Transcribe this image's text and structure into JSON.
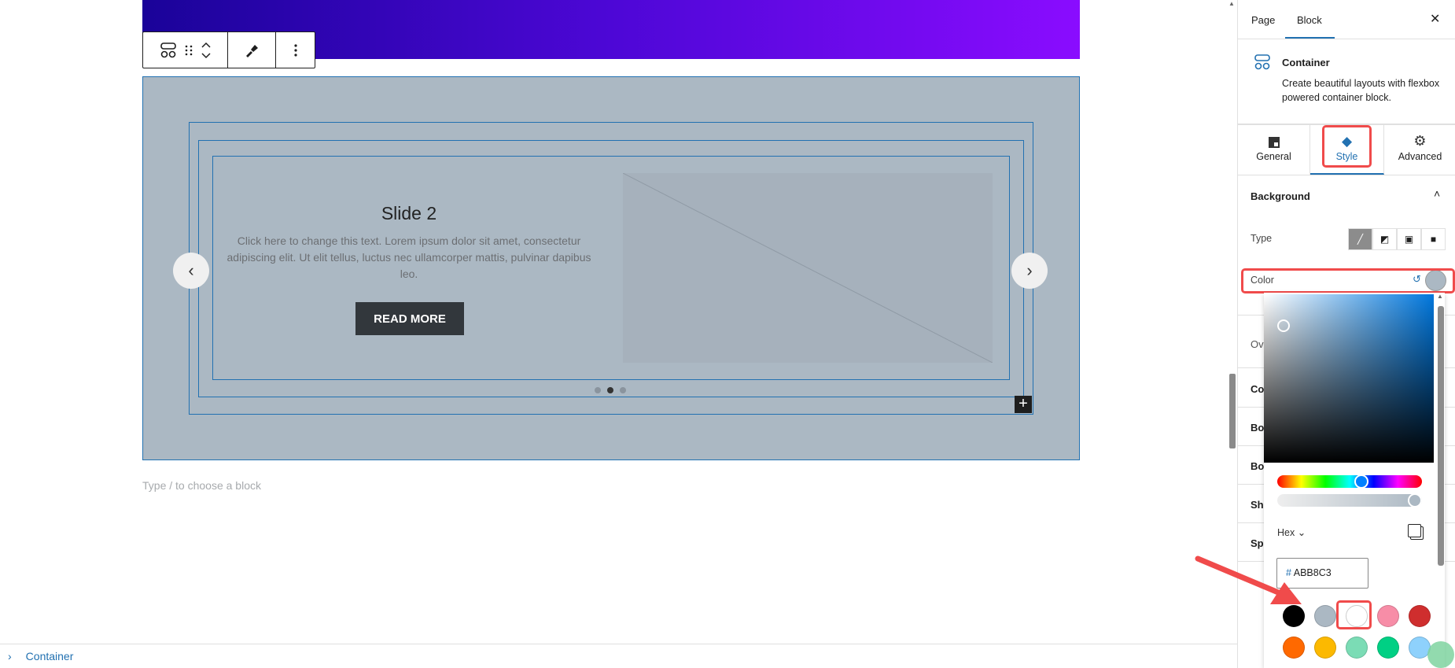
{
  "editor": {
    "toolbar": {
      "block_icon": "container-icon",
      "drag_icon": "drag-handle-icon",
      "move_icon": "move-up-down-icon",
      "style_icon": "paintbrush-icon",
      "more_icon": "more-vertical-icon"
    },
    "slide": {
      "title": "Slide 2",
      "body": "Click here to change this text. Lorem ipsum dolor sit amet, consectetur adipiscing elit. Ut elit tellus, luctus nec ullamcorper mattis, pulvinar dapibus leo.",
      "button": "READ MORE",
      "prev": "‹",
      "next": "›",
      "dots": 3,
      "active_dot": 2
    },
    "add_block": "+",
    "placeholder": "Type / to choose a block",
    "breadcrumb": {
      "chevron": "›",
      "label": "Container"
    }
  },
  "sidebar": {
    "tabs": [
      "Page",
      "Block"
    ],
    "active_tab": "Block",
    "close": "✕",
    "block": {
      "name": "Container",
      "description": "Create beautiful layouts with flexbox powered container block."
    },
    "sub_tabs": [
      {
        "label": "General",
        "icon": "general-icon"
      },
      {
        "label": "Style",
        "icon": "paint-bucket-icon"
      },
      {
        "label": "Advanced",
        "icon": "gear-icon"
      }
    ],
    "active_sub_tab": "Style",
    "background": {
      "title": "Background",
      "type_label": "Type",
      "types": [
        "classic",
        "gradient",
        "image",
        "video"
      ],
      "active_type": "classic",
      "color_label": "Color",
      "color_value": "#abb8c3"
    },
    "collapsed_sections": [
      "Ov",
      "Co",
      "Bo",
      "Bo",
      "Sh",
      "Sp"
    ],
    "picker": {
      "format": "Hex",
      "hex": "ABB8C3",
      "hash": "#",
      "hue_percent": 59,
      "alpha_percent": 100,
      "swatches": [
        "#000000",
        "#abb8c3",
        "#ffffff",
        "#f78da7",
        "#cf2e2e",
        "#ff6900",
        "#fcb900",
        "#7bdcb5",
        "#00d084",
        "#8ed1fc"
      ],
      "selected_swatch": 1
    }
  },
  "colors": {
    "accent": "#2271b1",
    "container_bg": "#abb8c3",
    "annotation": "#f04b4b"
  }
}
